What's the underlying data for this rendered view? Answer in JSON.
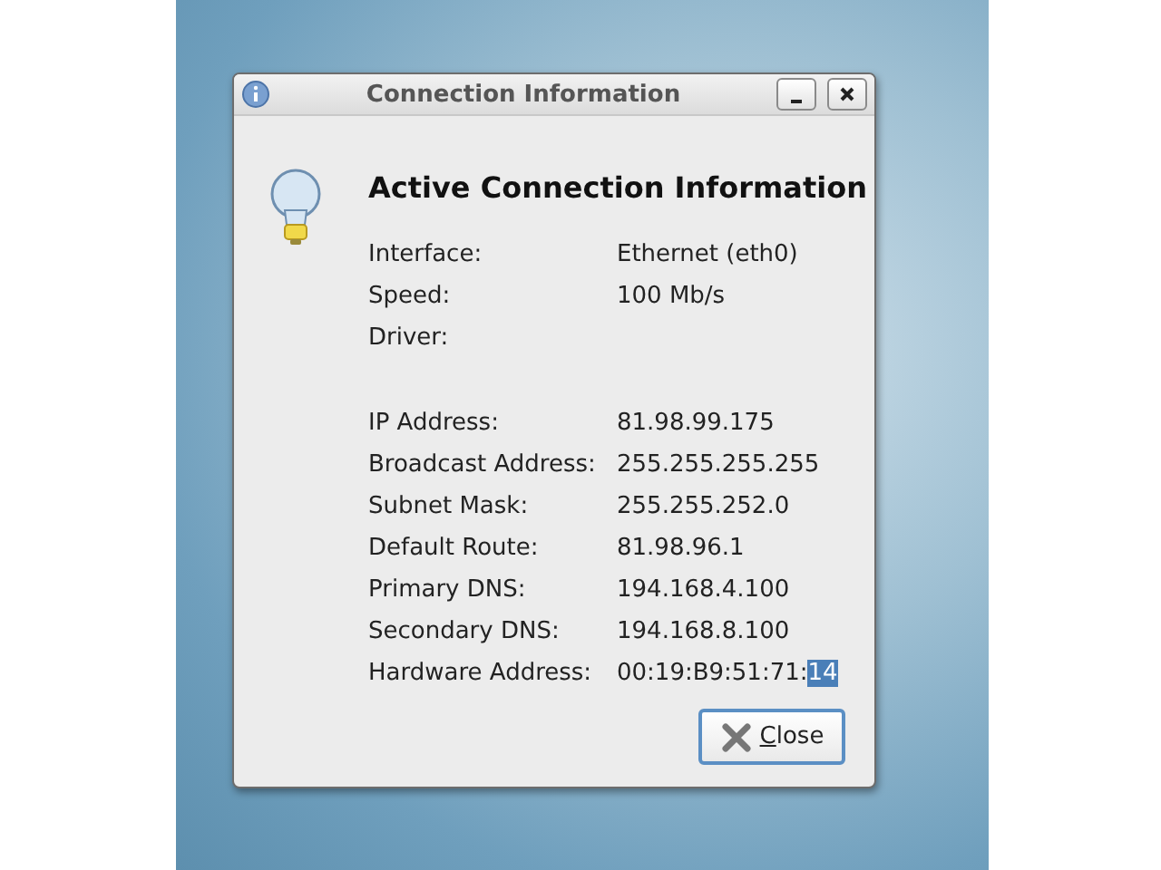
{
  "window": {
    "title": "Connection Information",
    "buttons": [
      {
        "kind": "minimize"
      },
      {
        "kind": "close"
      }
    ]
  },
  "heading": "Active Connection Information",
  "groups": [
    [
      {
        "label": "Interface:",
        "value": "Ethernet (eth0)"
      },
      {
        "label": "Speed:",
        "value": "100 Mb/s"
      },
      {
        "label": "Driver:"
      }
    ],
    [
      {
        "label": "IP Address:",
        "value": "81.98.99.175"
      },
      {
        "label": "Broadcast Address:",
        "value": "255.255.255.255"
      },
      {
        "label": "Subnet Mask:",
        "value": "255.255.252.0"
      },
      {
        "label": "Default Route:",
        "value": "81.98.96.1"
      },
      {
        "label": "Primary DNS:",
        "value": "194.168.4.100"
      },
      {
        "label": "Secondary DNS:",
        "value": "194.168.8.100"
      },
      {
        "label": "Hardware Address:",
        "value": "00:19:B9:51:71:",
        "selected_text": "14"
      }
    ]
  ],
  "close_button": {
    "label": "Close"
  }
}
